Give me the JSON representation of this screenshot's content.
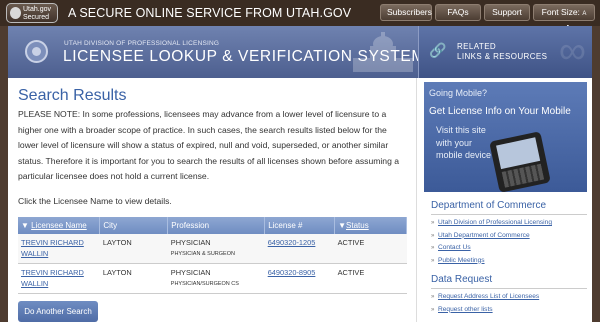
{
  "top_bar": {
    "badge_line1": "Utah.gov",
    "badge_line2": "Secured",
    "secure_title": "A SECURE ONLINE SERVICE FROM UTAH.GOV",
    "nav": [
      "Subscribers",
      "FAQs",
      "Support"
    ],
    "font_size_label": "Font Size:",
    "font_size_options": [
      "A",
      "A",
      "A"
    ]
  },
  "header": {
    "division": "UTAH DIVISION OF PROFESSIONAL LICENSING",
    "system_title": "LICENSEE LOOKUP & VERIFICATION SYSTEM",
    "related_line1": "RELATED",
    "related_line2": "LINKS & RESOURCES"
  },
  "main": {
    "title": "Search Results",
    "note": "PLEASE NOTE: In some professions, licensees may advance from a lower level of licensure to a higher one with a broader scope of practice. In such cases, the search results listed below for the lower level of licensure will show a status of expired, null and void, superseded, or another similar status. Therefore it is important for you to search the results of all licenses shown before assuming a particular licensee does not hold a current license.",
    "click_note": "Click the Licensee Name to view details.",
    "table": {
      "headers": [
        "Licensee Name",
        "City",
        "Profession",
        "License #",
        "Status"
      ],
      "rows": [
        {
          "name": "TREVIN RICHARD WALLIN",
          "city": "LAYTON",
          "profession": "PHYSICIAN",
          "profession_sub": "PHYSICIAN & SURGEON",
          "license": "6490320-1205",
          "status": "ACTIVE"
        },
        {
          "name": "TREVIN RICHARD WALLIN",
          "city": "LAYTON",
          "profession": "PHYSICIAN",
          "profession_sub": "PHYSICIAN/SURGEON CS",
          "license": "6490320-8905",
          "status": "ACTIVE"
        }
      ]
    },
    "do_another_label": "Do Another Search"
  },
  "sidebar": {
    "mobile_going": "Going Mobile?",
    "mobile_getinfo": "Get License Info on Your Mobile",
    "mobile_visit": "Visit this site with your mobile device",
    "commerce_heading": "Department of Commerce",
    "commerce_links": [
      "Utah Division of Professional Licensing",
      "Utah Department of Commerce",
      "Contact Us",
      "Public Meetings"
    ],
    "data_heading": "Data Request",
    "data_links": [
      "Request Address List of Licensees",
      "Request other lists"
    ]
  },
  "colors": {
    "accent": "#3a62a6",
    "header_blue": "#5d74a8",
    "frame_brown": "#4e3c30"
  }
}
